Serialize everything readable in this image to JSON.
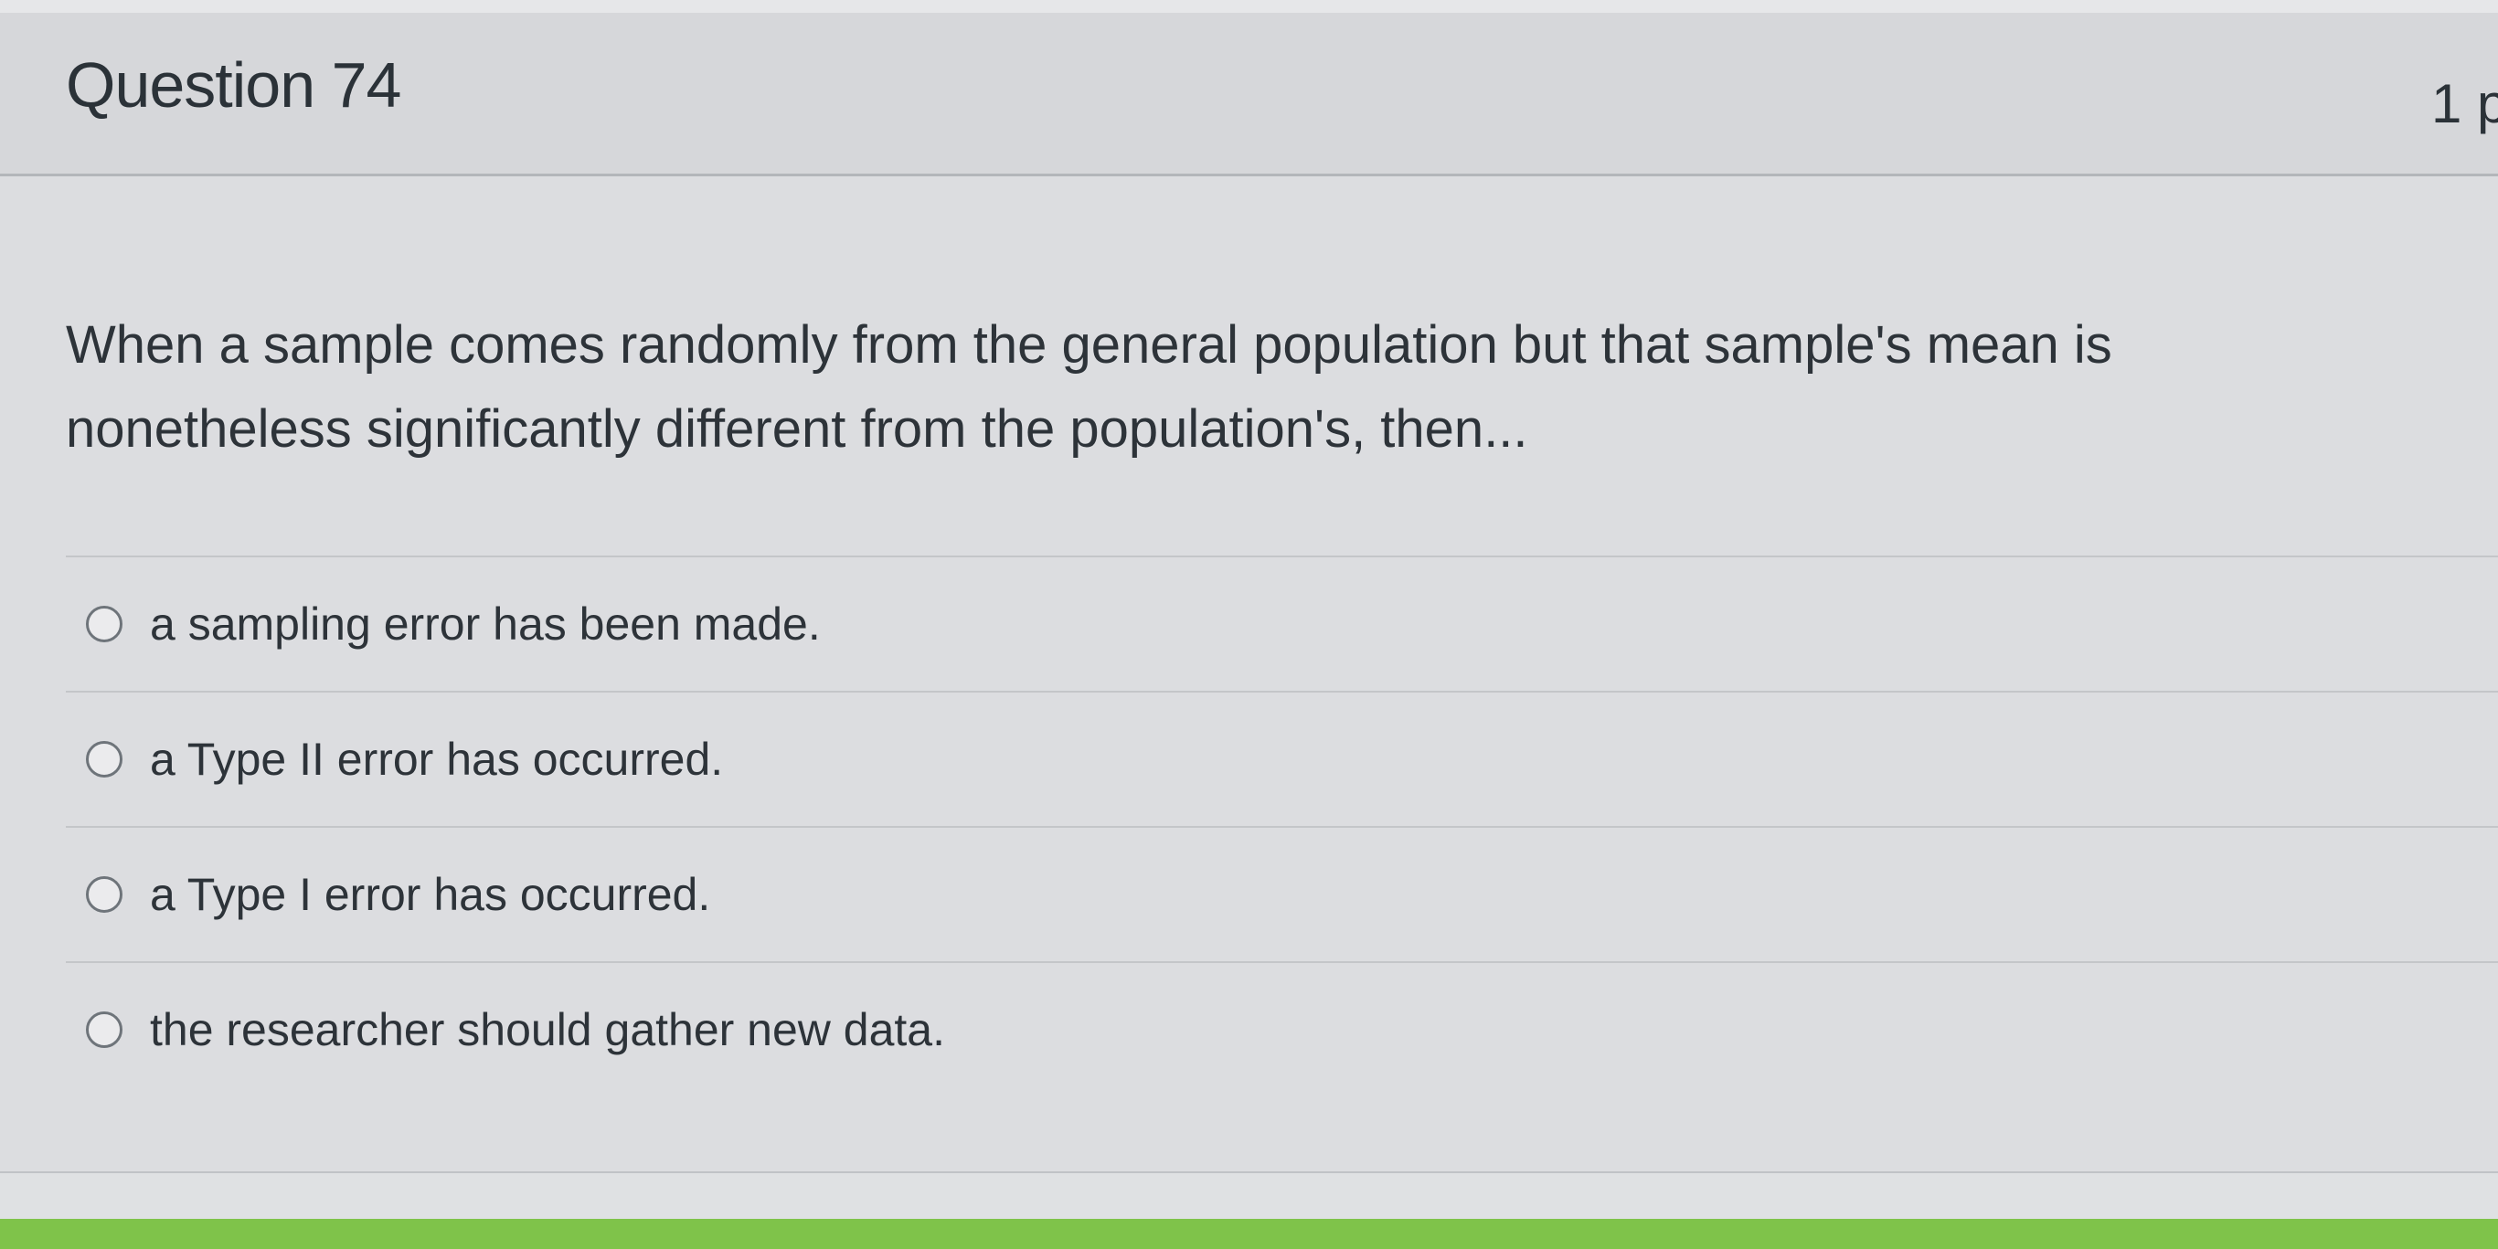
{
  "question": {
    "title": "Question 74",
    "points": "1 p",
    "text": "When a sample comes randomly from the general population but that sample's mean is nonetheless significantly different from the population's, then...",
    "answers": [
      {
        "label": "a sampling error has been made."
      },
      {
        "label": "a Type II error has occurred."
      },
      {
        "label": "a Type I error has occurred."
      },
      {
        "label": "the researcher should gather new data."
      }
    ]
  },
  "colors": {
    "accent_bar": "#7fc34a",
    "background": "#d9dadc"
  }
}
